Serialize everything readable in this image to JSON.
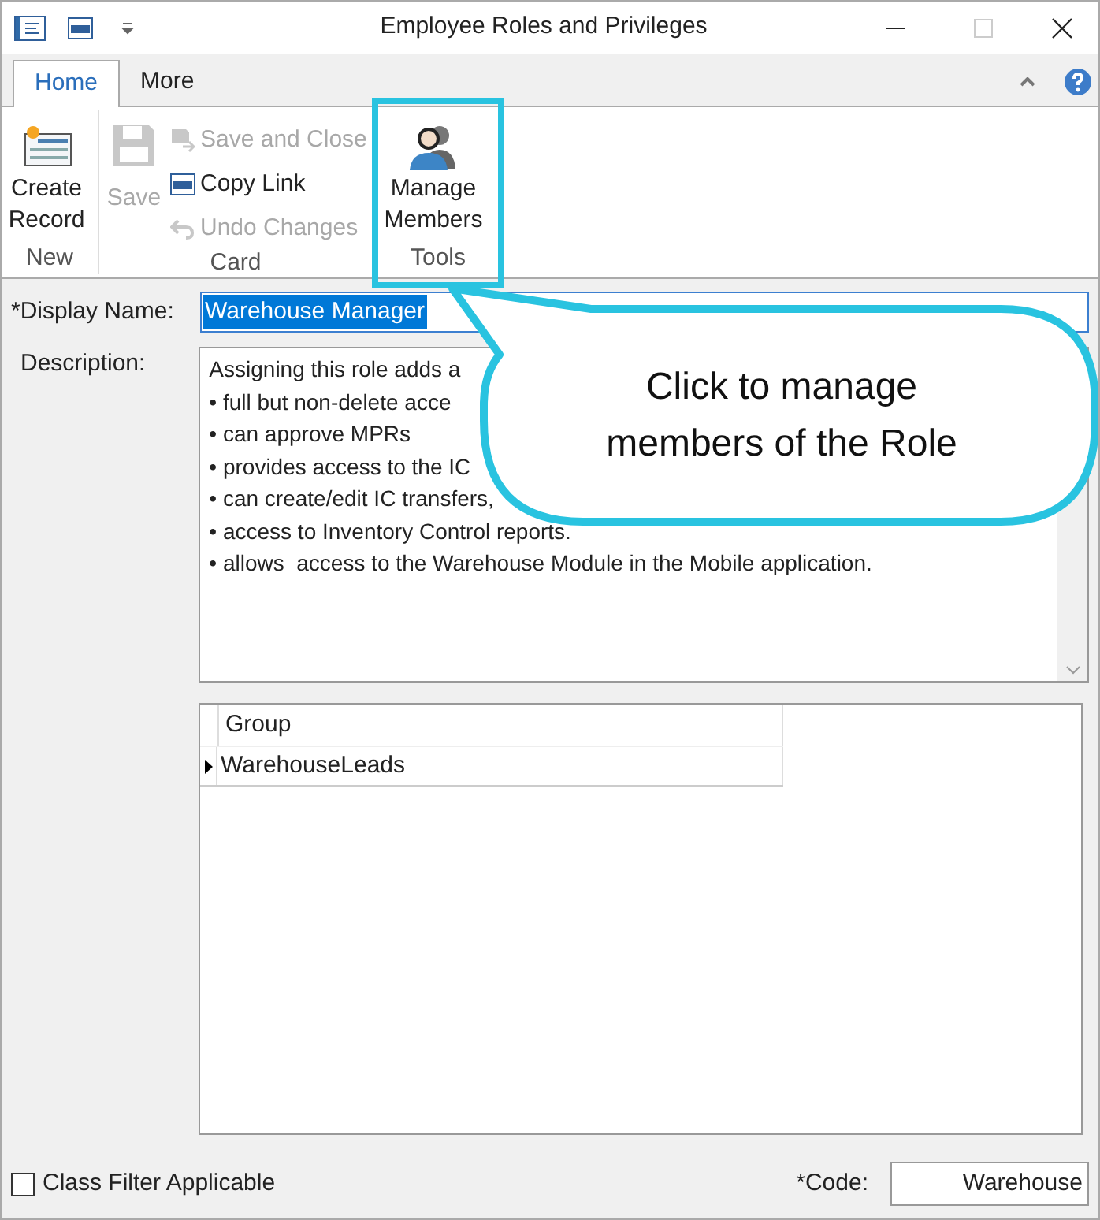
{
  "window": {
    "title": "Employee Roles and Privileges"
  },
  "ribbon": {
    "tabs": [
      {
        "label": "Home",
        "selected": true
      },
      {
        "label": "More",
        "selected": false
      }
    ],
    "groups": [
      {
        "label": "New",
        "items": [
          {
            "kind": "large",
            "label": "Create Record",
            "disabled": false
          }
        ]
      },
      {
        "label": "Card",
        "items": [
          {
            "kind": "large",
            "label": "Save",
            "disabled": true
          },
          {
            "kind": "small",
            "label": "Save and Close",
            "disabled": true
          },
          {
            "kind": "small",
            "label": "Copy Link",
            "disabled": false
          },
          {
            "kind": "small",
            "label": "Undo Changes",
            "disabled": true
          }
        ]
      },
      {
        "label": "Tools",
        "items": [
          {
            "kind": "large",
            "label": "Manage Members",
            "disabled": false
          }
        ]
      }
    ]
  },
  "form": {
    "display_name": {
      "label": "*Display Name:",
      "value": "Warehouse Manager",
      "text_selected": true
    },
    "description": {
      "label": "Description:",
      "lines": [
        "Assigning this role adds a",
        "• full but non-delete acce",
        "• can approve MPRs",
        "• provides access to the IC",
        "• can create/edit IC transfers,",
        "• access to Inventory Control reports.",
        "• allows  access to the Warehouse Module in the Mobile application."
      ]
    },
    "grid": {
      "columns": [
        "Group"
      ],
      "rows": [
        {
          "cells": [
            "WarehouseLeads"
          ],
          "selected": true
        }
      ]
    },
    "class_filter": {
      "label": "Class Filter Applicable",
      "checked": false
    },
    "code": {
      "label": "*Code:",
      "value": "Warehouse"
    }
  },
  "callout": {
    "text": "Click to manage members of the Role"
  }
}
